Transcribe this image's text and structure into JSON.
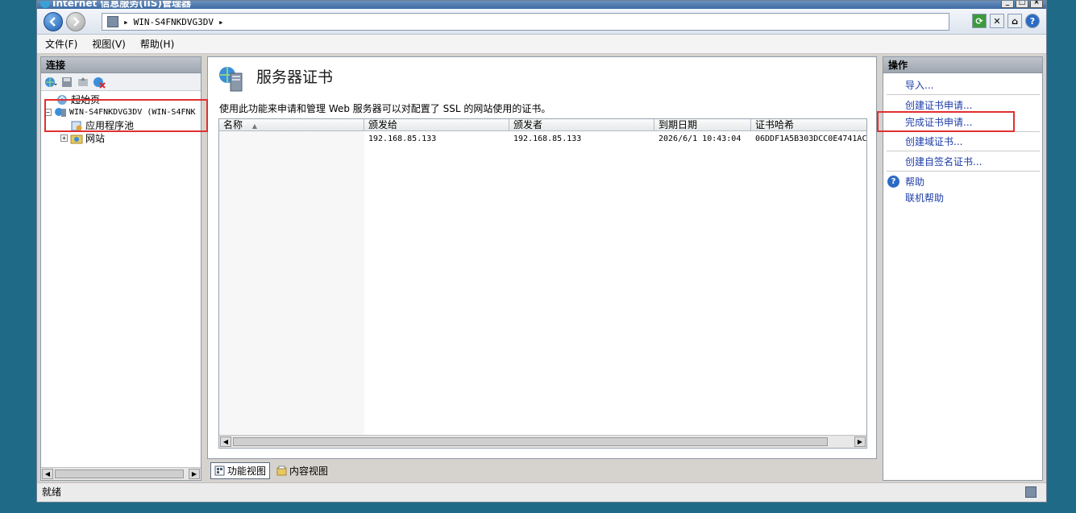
{
  "window": {
    "title": "Internet 信息服务(IIS)管理器",
    "controls": [
      "_",
      "□",
      "×"
    ]
  },
  "navbar": {
    "address_path": "WIN-S4FNKDVG3DV",
    "arrow": "▸",
    "back_icon": "back-arrow-icon",
    "forward_icon": "forward-arrow-icon"
  },
  "menu": {
    "items": [
      "文件(F)",
      "视图(V)",
      "帮助(H)"
    ]
  },
  "connections": {
    "header": "连接",
    "tree": [
      {
        "label": "起始页",
        "icon": "start-page-icon"
      },
      {
        "label": "WIN-S4FNKDVG3DV (WIN-S4FNK",
        "icon": "server-icon",
        "expanded": true
      },
      {
        "label": "应用程序池",
        "icon": "app-pool-icon"
      },
      {
        "label": "网站",
        "icon": "sites-icon",
        "expanded": false
      }
    ]
  },
  "main": {
    "title": "服务器证书",
    "description": "使用此功能来申请和管理 Web 服务器可以对配置了 SSL 的网站使用的证书。",
    "columns": [
      "名称",
      "颁发给",
      "颁发者",
      "到期日期",
      "证书哈希"
    ],
    "sort_indicator": "▲",
    "rows": [
      {
        "name": "",
        "issued_to": "192.168.85.133",
        "issued_by": "192.168.85.133",
        "expiry": "2026/6/1 10:43:04",
        "hash": "06DDF1A5B303DCC0E4741AC"
      }
    ]
  },
  "view_tabs": {
    "features": "功能视图",
    "content": "内容视图"
  },
  "actions": {
    "header": "操作",
    "items": [
      "导入...",
      "创建证书申请...",
      "完成证书申请...",
      "创建域证书...",
      "创建自签名证书..."
    ],
    "help": "帮助",
    "online_help": "联机帮助"
  },
  "status": {
    "text": "就绪"
  },
  "colors": {
    "desktop": "#1f6a86",
    "action_link": "#1d3ca8",
    "highlight": "#e03030"
  }
}
